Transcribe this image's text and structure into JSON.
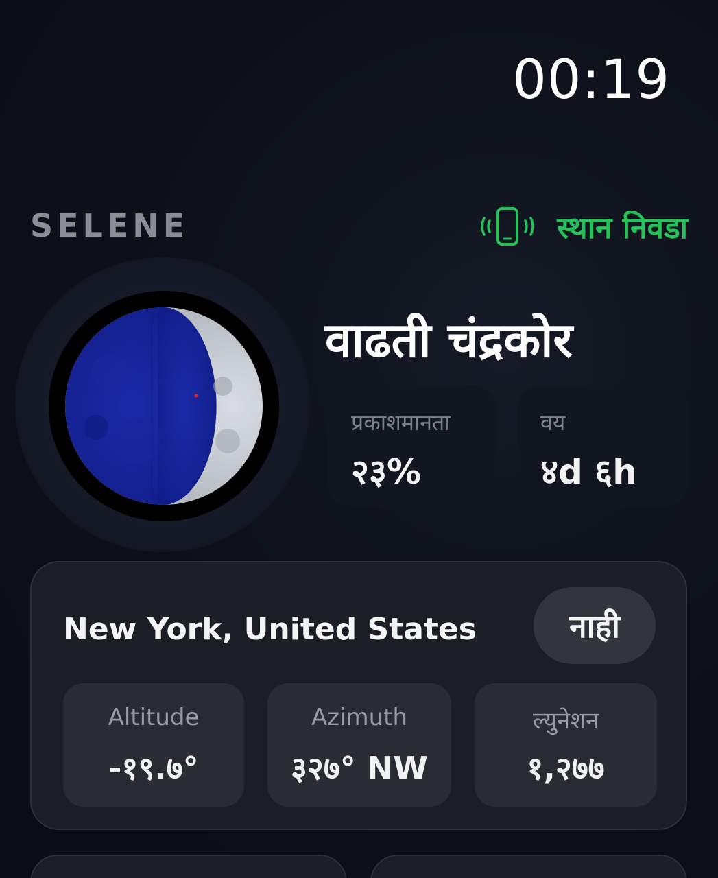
{
  "status": {
    "time": "00:19"
  },
  "header": {
    "app_name": "SELENE",
    "location_picker_label": "स्थान निवडा",
    "accent_color": "#25c25a"
  },
  "moon": {
    "phase_name": "वाढती चंद्रकोर",
    "illumination": {
      "label": "प्रकाशमानता",
      "value": "२३%"
    },
    "age": {
      "label": "वय",
      "value": "४d ६h"
    }
  },
  "location_card": {
    "name": "New York, United States",
    "toggle_label": "नाही",
    "stats": [
      {
        "label": "Altitude",
        "value": "-१९.७°"
      },
      {
        "label": "Azimuth",
        "value": "३२७° NW"
      },
      {
        "label": "ल्युनेशन",
        "value": "१,२७७"
      }
    ]
  }
}
